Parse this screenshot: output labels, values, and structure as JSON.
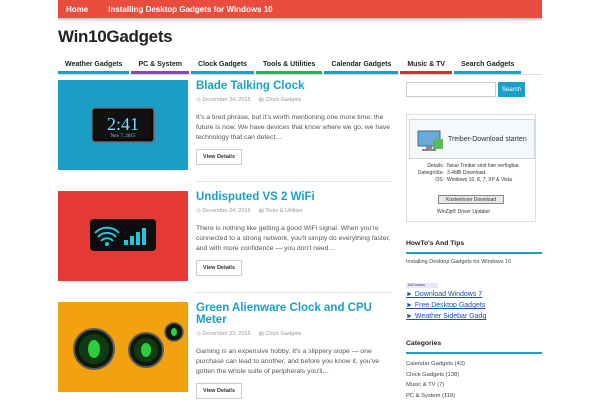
{
  "topnav": {
    "home": "Home",
    "article": "Installing Desktop Gadgets for Windows 10"
  },
  "site": {
    "title": "Win10Gadgets"
  },
  "categories_nav": [
    {
      "label": "Weather Gadgets",
      "color": "#1aa0c8"
    },
    {
      "label": "PC & System",
      "color": "#8e44ad"
    },
    {
      "label": "Clock Gadgets",
      "color": "#1aa0c8"
    },
    {
      "label": "Tools & Utilities",
      "color": "#27ae60"
    },
    {
      "label": "Calendar Gadgets",
      "color": "#1aa0c8"
    },
    {
      "label": "Music & TV",
      "color": "#c0392b"
    },
    {
      "label": "Search Gadgets",
      "color": "#1aa0c8"
    }
  ],
  "posts": [
    {
      "title": "Blade Talking Clock",
      "date": "December 24, 2015",
      "category": "Clock Gadgets",
      "excerpt": "It's a tired phrase, but it's worth mentioning one more time: the future is now. We have devices that know where we go, we have technology that can detect…",
      "button": "View Details",
      "thumb_time": "2:41",
      "thumb_date": "Nov 7, 2015"
    },
    {
      "title": "Undisputed VS 2 WiFi",
      "date": "December 24, 2015",
      "category": "Tools & Utilities",
      "excerpt": "There is nothing like getting a good WiFi signal. When you're connected to a strong network, you'll simply do everything faster, and with more confidence — you don't need…",
      "button": "View Details"
    },
    {
      "title": "Green Alienware Clock and CPU Meter",
      "date": "December 23, 2015",
      "category": "Clock Gadgets",
      "excerpt": "Gaming is an expensive hobby. It's a slippery slope — one purchase can lead to another, and before you know it, you've gotten the whole suite of peripherals you'll…",
      "button": "View Details"
    }
  ],
  "sidebar": {
    "search_button": "Search",
    "ad": {
      "headline": "Treiber-Download starten",
      "details_label": "Details:",
      "details_value": "Neue Treiber sind hier verfügbar.",
      "size_label": "Dateigröße:",
      "size_value": "3.4MB Download.",
      "os_label": "OS:",
      "os_value": "Windows 10, 8, 7, XP & Vista",
      "download_button": "Kostenloser Download",
      "footer": "WinZip® Driver Updater"
    },
    "howto": {
      "title": "HowTo's And Tips",
      "link": "Installing Desktop Gadgets for Windows 10"
    },
    "adchoices": "AdChoices",
    "ad_links": [
      "► Download Windows 7",
      "► Free Desktop Gadgets",
      "► Weather Sidebar Gadg"
    ],
    "categories": {
      "title": "Categories",
      "items": [
        "Calendar Gadgets (43)",
        "Clock Gadgets (138)",
        "Music & TV (7)",
        "PC & System (118)"
      ]
    }
  }
}
